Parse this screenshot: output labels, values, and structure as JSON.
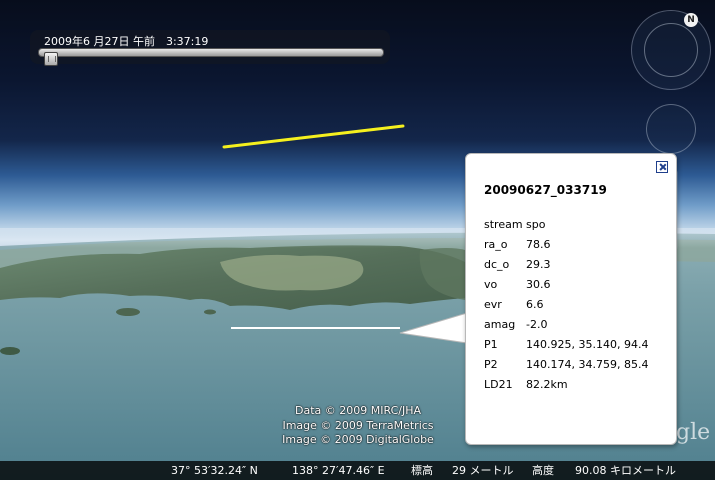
{
  "time_slider": {
    "label": "2009年6 月27日 午前　3:37:19",
    "position": 0.02
  },
  "navigation": {
    "north_label": "N",
    "icons": [
      "north-icon",
      "compass-ring",
      "look-joystick",
      "zoom-slider"
    ]
  },
  "balloon": {
    "title": "20090627_033719",
    "rows": [
      {
        "key": "stream",
        "value": "spo"
      },
      {
        "key": "ra_o",
        "value": "78.6"
      },
      {
        "key": "dc_o",
        "value": "29.3"
      },
      {
        "key": "vo",
        "value": "30.6"
      },
      {
        "key": "evr",
        "value": "6.6"
      },
      {
        "key": "amag",
        "value": "-2.0"
      },
      {
        "key": "P1",
        "value": "140.925, 35.140, 94.4"
      },
      {
        "key": "P2",
        "value": "140.174, 34.759, 85.4"
      },
      {
        "key": "LD21",
        "value": "82.2km"
      }
    ],
    "close_icon": "close-icon"
  },
  "attribution": {
    "line1": "Data © 2009 MIRC/JHA",
    "line2": "Image © 2009 TerraMetrics",
    "line3": "Image © 2009 DigitalGlobe"
  },
  "logo_fragment": "gle",
  "status_bar": {
    "lat": "37° 53′32.24″ N",
    "lon": "138° 27′47.46″ E",
    "elev_label": "標高",
    "elev_value": "29 メートル",
    "alt_label": "高度",
    "alt_value": "90.08 キロメートル"
  },
  "colors": {
    "meteor_track": "#f5f01e",
    "ground_track": "#ffffff",
    "close_icon": "#1f3f8c"
  }
}
